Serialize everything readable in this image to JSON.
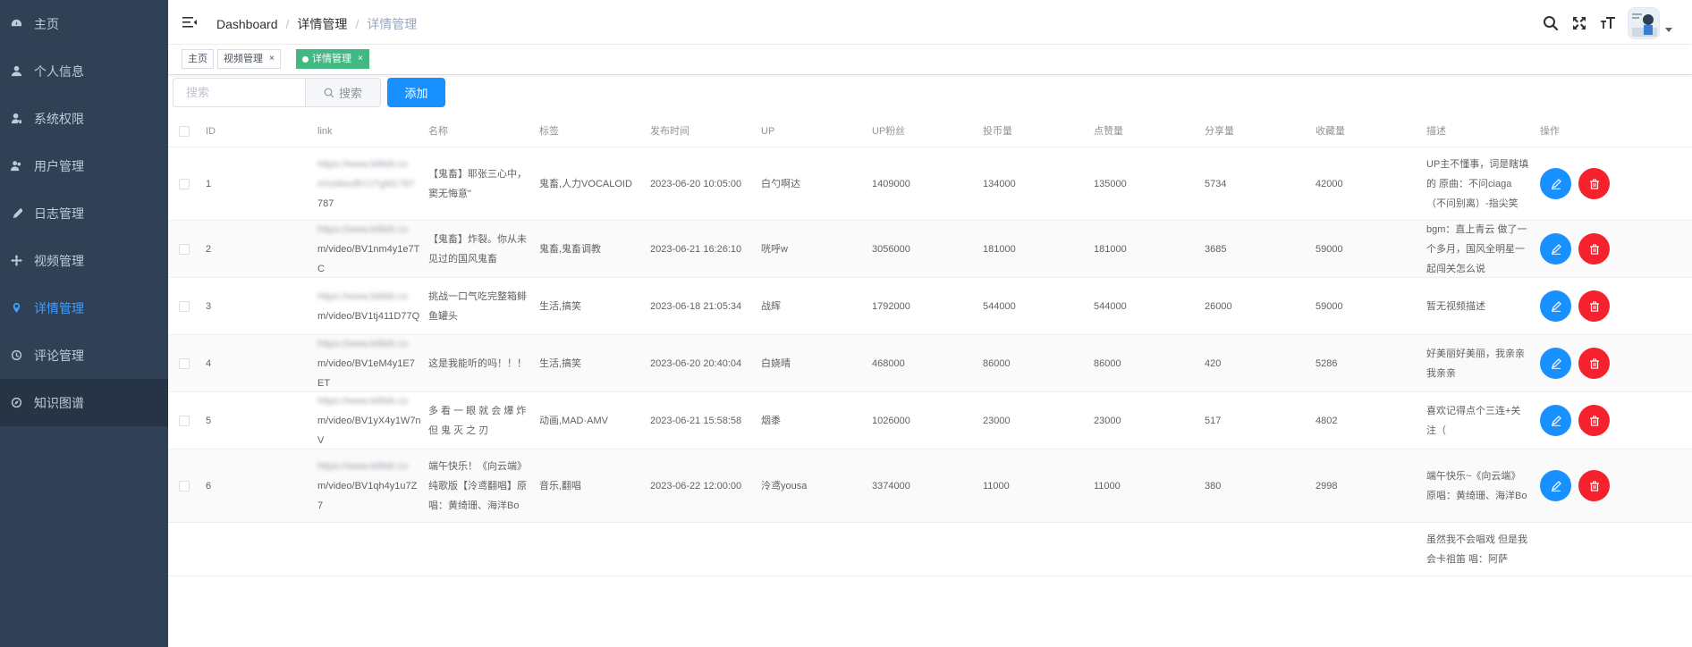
{
  "sidebar": {
    "items": [
      {
        "label": "主页",
        "icon": "dashboard-icon",
        "active": false,
        "hover": false
      },
      {
        "label": "个人信息",
        "icon": "user-icon",
        "active": false,
        "hover": false
      },
      {
        "label": "系统权限",
        "icon": "permission-icon",
        "active": false,
        "hover": false
      },
      {
        "label": "用户管理",
        "icon": "users-icon",
        "active": false,
        "hover": false
      },
      {
        "label": "日志管理",
        "icon": "pen-icon",
        "active": false,
        "hover": false
      },
      {
        "label": "视频管理",
        "icon": "move-icon",
        "active": false,
        "hover": false
      },
      {
        "label": "详情管理",
        "icon": "location-icon",
        "active": true,
        "hover": false
      },
      {
        "label": "评论管理",
        "icon": "clock-icon",
        "active": false,
        "hover": false
      },
      {
        "label": "知识图谱",
        "icon": "compass-icon",
        "active": false,
        "hover": true
      }
    ]
  },
  "breadcrumb": {
    "items": [
      "Dashboard",
      "详情管理",
      "详情管理"
    ]
  },
  "tags": {
    "home": "主页",
    "video": "视频管理",
    "detail": "详情管理",
    "close": "×"
  },
  "search": {
    "placeholder": "搜索",
    "button_label": "搜索",
    "add_label": "添加"
  },
  "table": {
    "headers": {
      "id": "ID",
      "link": "link",
      "name": "名称",
      "tag": "标签",
      "time": "发布时间",
      "up": "UP",
      "fans": "UP粉丝",
      "coin": "投币量",
      "like": "点赞量",
      "share": "分享量",
      "fav": "收藏量",
      "desc": "描述",
      "ops": "操作"
    },
    "rows": [
      {
        "id": "1",
        "link_hidden": "https://www.bilibili.co",
        "link_hidden2": "m/video/BV1TgM1787",
        "link_tail": "787",
        "name": "【鬼畜】耶张三心中，窦无悔意\"",
        "tag": "鬼畜,人力VOCALOID",
        "time": "2023-06-20 10:05:00",
        "up": "白勺啊达",
        "fans": "1409000",
        "coin": "134000",
        "like": "135000",
        "share": "5734",
        "fav": "42000",
        "desc": "UP主不懂事，词是瞎填的 原曲：不问ciaga（不问别离）-指尖笑"
      },
      {
        "id": "2",
        "link_hidden": "https://www.bilibili.co",
        "link_hidden2": "",
        "link_tail": "m/video/BV1nm4y1e7TC",
        "name": "【鬼畜】炸裂。你从未见过的国风鬼畜",
        "tag": "鬼畜,鬼畜调教",
        "time": "2023-06-21 16:26:10",
        "up": "咣呼w",
        "fans": "3056000",
        "coin": "181000",
        "like": "181000",
        "share": "3685",
        "fav": "59000",
        "desc": "bgm：直上青云 做了一个多月，国风全明星一起闯关怎么说"
      },
      {
        "id": "3",
        "link_hidden": "https://www.bilibili.co",
        "link_hidden2": "",
        "link_tail": "m/video/BV1tj411D77Q",
        "name": "挑战一口气吃完整箱鲱鱼罐头",
        "tag": "生活,搞笑",
        "time": "2023-06-18 21:05:34",
        "up": "战辉",
        "fans": "1792000",
        "coin": "544000",
        "like": "544000",
        "share": "26000",
        "fav": "59000",
        "desc": "暂无视频描述"
      },
      {
        "id": "4",
        "link_hidden": "https://www.bilibili.co",
        "link_hidden2": "",
        "link_tail": "m/video/BV1eM4y1E7ET",
        "name": "这是我能听的吗！！！",
        "tag": "生活,搞笑",
        "time": "2023-06-20 20:40:04",
        "up": "白娆晴",
        "fans": "468000",
        "coin": "86000",
        "like": "86000",
        "share": "420",
        "fav": "5286",
        "desc": "好美丽好美丽，我亲亲我亲亲"
      },
      {
        "id": "5",
        "link_hidden": "https://www.bilibili.co",
        "link_hidden2": "",
        "link_tail": "m/video/BV1yX4y1W7nV",
        "name": "多 看 一 眼 就 会 爆 炸 但 鬼 灭 之 刃",
        "tag": "动画,MAD·AMV",
        "time": "2023-06-21 15:58:58",
        "up": "烟黍",
        "fans": "1026000",
        "coin": "23000",
        "like": "23000",
        "share": "517",
        "fav": "4802",
        "desc": "喜欢记得点个三连+关注（"
      },
      {
        "id": "6",
        "link_hidden": "https://www.bilibili.co",
        "link_hidden2": "",
        "link_tail": "m/video/BV1qh4y1u7Z7",
        "name": "端午快乐！《向云端》纯歌版【泠鸢翻唱】原唱：黄绮珊、海洋Bo",
        "tag": "音乐,翻唱",
        "time": "2023-06-22 12:00:00",
        "up": "泠鸢yousa",
        "fans": "3374000",
        "coin": "11000",
        "like": "11000",
        "share": "380",
        "fav": "2998",
        "desc": "端午快乐~《向云端》原唱：黄绮珊、海洋Bo"
      },
      {
        "id": "",
        "link_hidden": "",
        "link_hidden2": "",
        "link_tail": "",
        "name": "",
        "tag": "",
        "time": "",
        "up": "",
        "fans": "",
        "coin": "",
        "like": "",
        "share": "",
        "fav": "",
        "desc": "虽然我不会唱戏 但是我会卡祖笛 唱：阿萨"
      }
    ]
  },
  "colors": {
    "sidebar_bg": "#304156",
    "accent": "#409eff",
    "primary_btn": "#1890ff",
    "danger": "#f5222d",
    "tag_active": "#42b983"
  }
}
